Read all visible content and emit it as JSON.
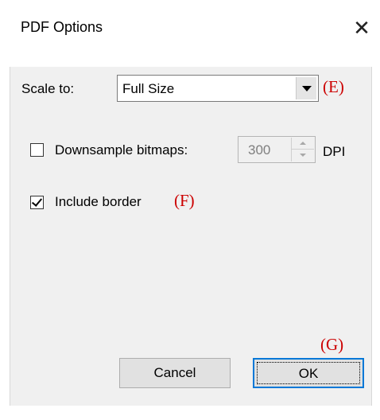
{
  "window": {
    "title": "PDF Options",
    "close_glyph": "✕"
  },
  "scale": {
    "label": "Scale to:",
    "value": "Full Size",
    "annotation": "(E)"
  },
  "downsample": {
    "label": "Downsample bitmaps:",
    "checked": false,
    "value": "300",
    "unit": "DPI",
    "enabled": false
  },
  "border": {
    "label": "Include border",
    "checked": true,
    "annotation": "(F)"
  },
  "buttons": {
    "cancel": "Cancel",
    "ok": "OK",
    "annotation": "(G)"
  },
  "icons": {
    "close": "close-icon",
    "dropdown": "chevron-down-icon",
    "spin_up": "spin-up-icon",
    "spin_down": "spin-down-icon"
  }
}
